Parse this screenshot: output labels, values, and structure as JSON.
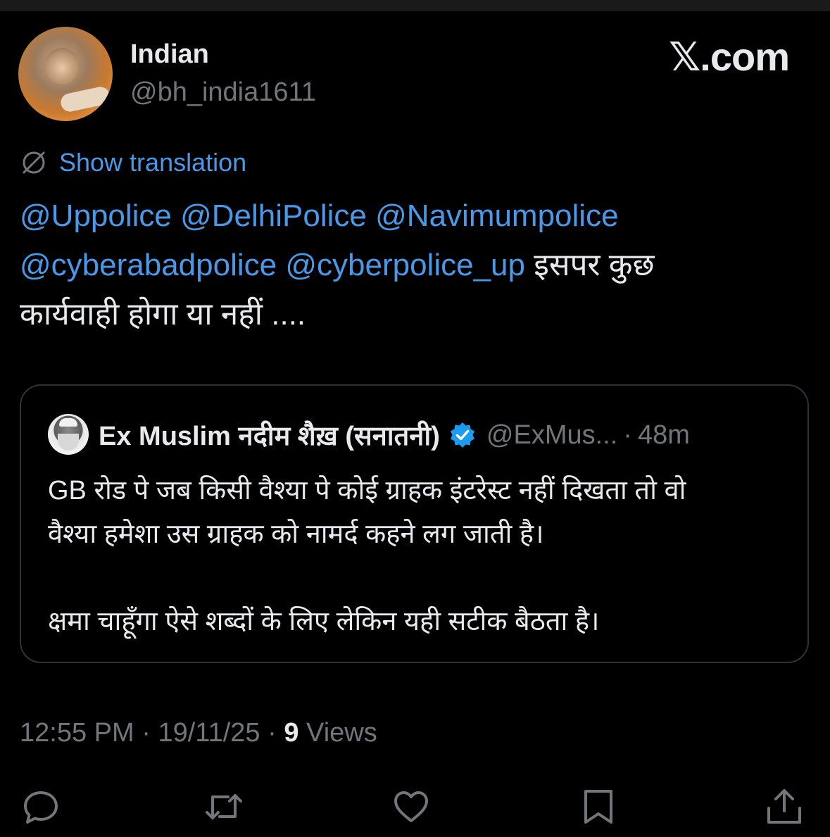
{
  "author": {
    "name": "Indian",
    "handle": "@bh_india1611"
  },
  "brand": "𝕏.com",
  "translation": {
    "label": "Show translation",
    "icon": "globe-icon"
  },
  "tweet": {
    "mentions": [
      "@Uppolice",
      "@DelhiPolice",
      "@Navimumpolice",
      "@cyberabadpolice",
      "@cyberpolice_up"
    ],
    "text_tail_1": "इसपर कुछ",
    "text_tail_2": "कार्यवाही होगा या नहीं ...."
  },
  "quote": {
    "name": "Ex Muslim नदीम शैख़ (सनातनी)",
    "handle": "@ExMus...",
    "separator": "·",
    "time": "48m",
    "verified_icon": "verified-badge-icon",
    "line_1": "GB रोड पे जब किसी वैश्या पे कोई ग्राहक इंटरेस्ट नहीं दिखता तो वो",
    "line_2": "वैश्या हमेशा उस ग्राहक को नामर्द कहने लग जाती है।",
    "line_3": "क्षमा चाहूँगा ऐसे शब्दों के लिए लेकिन यही सटीक बैठता है।"
  },
  "meta": {
    "time": "12:55 PM",
    "sep": "·",
    "date": "19/11/25",
    "views_count": "9",
    "views_label": "Views"
  },
  "actions": {
    "reply": "reply-icon",
    "retweet": "retweet-icon",
    "like": "like-icon",
    "bookmark": "bookmark-icon",
    "share": "share-icon"
  },
  "colors": {
    "background": "#000000",
    "text": "#e7e9ea",
    "muted": "#71767b",
    "link": "#4a99e9",
    "border": "#2f3336",
    "verified": "#1d9bf0"
  }
}
